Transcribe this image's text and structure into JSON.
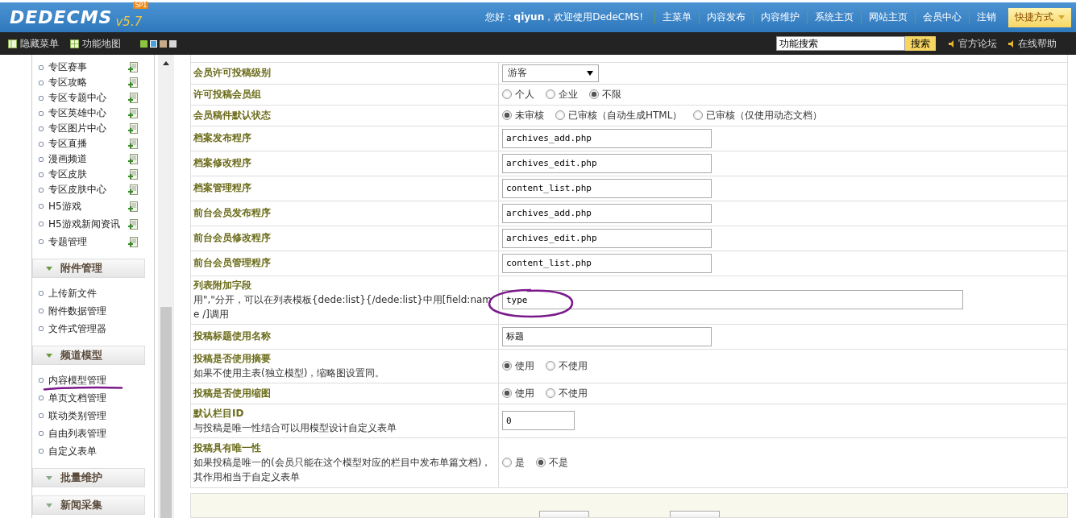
{
  "header": {
    "logo": "DEDECMS",
    "version": "v5.7",
    "badge": "SP1",
    "greeting": "您好：",
    "user": "qiyun",
    "welcome": "，欢迎使用DedeCMS!",
    "nav": [
      "主菜单",
      "内容发布",
      "内容维护",
      "系统主页",
      "网站主页",
      "会员中心",
      "注销"
    ],
    "shortcut": "快捷方式"
  },
  "toolbar": {
    "left": [
      "隐藏菜单",
      "功能地图"
    ],
    "swatches": [
      {
        "color": "#8cc63f",
        "selected": false
      },
      {
        "color": "#4a9fd8",
        "selected": true
      },
      {
        "color": "#c8aa88",
        "selected": false
      },
      {
        "color": "#d8d8d8",
        "selected": false
      }
    ],
    "search": {
      "value": "功能搜索"
    },
    "search_button": "搜索",
    "links": [
      "官方论坛",
      "在线帮助"
    ]
  },
  "sidebar": {
    "channel_items": [
      "专区赛事",
      "专区攻略",
      "专区专题中心",
      "专区英雄中心",
      "专区图片中心",
      "专区直播",
      "漫画频道",
      "专区皮肤",
      "专区皮肤中心",
      "H5游戏",
      "H5游戏新闻资讯",
      "专题管理"
    ],
    "groups": [
      {
        "title": "附件管理",
        "expanded": true,
        "items": [
          "上传新文件",
          "附件数据管理",
          "文件式管理器"
        ]
      },
      {
        "title": "频道模型",
        "expanded": true,
        "items": [
          "内容模型管理",
          "单页文档管理",
          "联动类别管理",
          "自由列表管理",
          "自定义表单"
        ]
      },
      {
        "title": "批量维护",
        "expanded": false
      },
      {
        "title": "新闻采集",
        "expanded": false
      }
    ]
  },
  "form": {
    "rows": [
      {
        "kind": "select",
        "label": "会员许可投稿级别",
        "value": "游客"
      },
      {
        "kind": "radio",
        "label": "许可投稿会员组",
        "options": [
          {
            "label": "个人",
            "selected": false
          },
          {
            "label": "企业",
            "selected": false
          },
          {
            "label": "不限",
            "selected": true
          }
        ]
      },
      {
        "kind": "radio",
        "label": "会员稿件默认状态",
        "options": [
          {
            "label": "未审核",
            "selected": true
          },
          {
            "label": "已审核（自动生成HTML）",
            "selected": false
          },
          {
            "label": "已审核（仅使用动态文档）",
            "selected": false
          }
        ]
      },
      {
        "kind": "text",
        "label": "档案发布程序",
        "value": "archives_add.php"
      },
      {
        "kind": "text",
        "label": "档案修改程序",
        "value": "archives_edit.php"
      },
      {
        "kind": "text",
        "label": "档案管理程序",
        "value": "content_list.php"
      },
      {
        "kind": "text",
        "label": "前台会员发布程序",
        "value": "archives_add.php"
      },
      {
        "kind": "text",
        "label": "前台会员修改程序",
        "value": "archives_edit.php"
      },
      {
        "kind": "text",
        "label": "前台会员管理程序",
        "value": "content_list.php"
      },
      {
        "kind": "wide",
        "label": "列表附加字段",
        "hint": "用\",\"分开，可以在列表模板{dede:list}{/dede:list}中用[field:name /]调用",
        "value": "type"
      },
      {
        "kind": "text",
        "label": "投稿标题使用名称",
        "value": "标题"
      },
      {
        "kind": "radio",
        "label": "投稿是否使用摘要",
        "hint": "如果不使用主表(独立模型)，缩略图设置同。",
        "options": [
          {
            "label": "使用",
            "selected": true
          },
          {
            "label": "不使用",
            "selected": false
          }
        ]
      },
      {
        "kind": "radio",
        "label": "投稿是否使用缩图",
        "options": [
          {
            "label": "使用",
            "selected": true
          },
          {
            "label": "不使用",
            "selected": false
          }
        ]
      },
      {
        "kind": "short",
        "label": "默认栏目ID",
        "hint": "与投稿是唯一性结合可以用模型设计自定义表单",
        "value": "0"
      },
      {
        "kind": "radio",
        "label": "投稿具有唯一性",
        "hint": "如果投稿是唯一的(会员只能在这个模型对应的栏目中发布单篇文档)，其作用相当于自定义表单",
        "options": [
          {
            "label": "是",
            "selected": false
          },
          {
            "label": "不是",
            "selected": true
          }
        ]
      }
    ]
  }
}
